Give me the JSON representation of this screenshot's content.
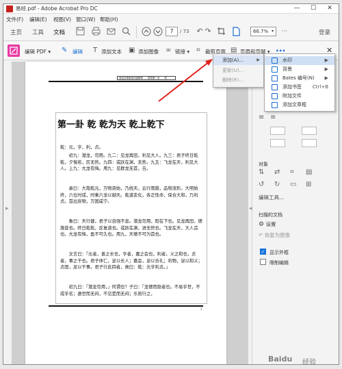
{
  "window": {
    "title": "易经.pdf - Adobe Acrobat Pro DC",
    "controls": [
      "—",
      "☐",
      "✕"
    ]
  },
  "menubar": [
    "文件(F)",
    "编辑(E)",
    "视图(V)",
    "窗口(W)",
    "帮助(H)"
  ],
  "toolbar": {
    "tabs": [
      "主页",
      "工具",
      "文档"
    ],
    "page_current": "7",
    "page_total": "/ 73",
    "zoom": "66.7%",
    "login": "登录"
  },
  "edit_toolbar": {
    "edit_pdf": "编辑 PDF ▾",
    "edit": "编辑",
    "add_text": "添加文本",
    "add_image": "添加图像",
    "link": "链接 ▾",
    "crop": "裁剪页面",
    "header_footer": "页眉和页脚 ▾",
    "more": "•••"
  },
  "dropdown_primary": {
    "items": [
      {
        "label": "添加(A)...",
        "highlighted": true,
        "disabled": false
      },
      {
        "label": "更新(U)...",
        "highlighted": false,
        "disabled": true
      },
      {
        "label": "删除(R)...",
        "highlighted": false,
        "disabled": true
      }
    ]
  },
  "dropdown_secondary": {
    "items": [
      {
        "label": "水印",
        "shortcut": "",
        "submenu": true,
        "highlighted": true
      },
      {
        "label": "背景",
        "shortcut": "",
        "submenu": true,
        "highlighted": false
      },
      {
        "label": "Bates 编号(N)",
        "shortcut": "",
        "submenu": true,
        "highlighted": false
      },
      {
        "label": "添加书签",
        "shortcut": "Ctrl+B",
        "submenu": false,
        "highlighted": false
      },
      {
        "label": "附加文件",
        "shortcut": "",
        "submenu": false,
        "highlighted": false
      },
      {
        "label": "添加文章框",
        "shortcut": "",
        "submenu": false,
        "highlighted": false
      }
    ]
  },
  "document": {
    "running_header": "易经卦象解读详细解释　　周易第一卦　　乾",
    "page_number": "1",
    "heading": "第一卦 乾 乾为天 乾上乾下",
    "paragraphs": [
      "乾：元，亨，利，贞。",
      "　　初九：潜龙，勿用。九二：见龙再田，利见大人。九三：君子终日乾乾，夕惕若，厉无咎。九四：或跃在渊，无咎。九五：飞龙在天，利见大人。上九：亢龙有悔。用九：见群龙无首，吉。",
      "　　彖曰：大哉乾元，万物资始，乃统天。云行雨施，品物流形。大明始终，六位时成，时乘六龙以御天。乾道变化，各正性命，保合大和，乃利贞。首出庶物，万国咸宁。",
      "　　象曰：天行健，君子以自强不息。潜龙勿用，阳在下也。见龙再田，德施普也。终日乾乾，反复道也。或跃在渊，进无咎也。飞龙在天，大人造也。亢龙有悔，盈不可久也。用九，天德不可为首也。",
      "　　文言曰：「元者，善之长也，亨者，嘉之会也，利者，义之和也，贞者，事之干也。君子体仁，足以长人；嘉会，足以合礼；利物，足以和义；贞固，足以干事。君子行此四者，故曰：乾：元亨利贞。」",
      "　　初九曰：「潜龙勿用，」何谓也？子曰：「龙德而隐者也。不易乎世，不成乎名；遯世而无闷，不见是而无闷；乐则行之，"
    ]
  },
  "right_pane": {
    "object_label": "对象",
    "edit_tools": "编辑工具...",
    "scanned_label": "扫描的文档",
    "settings": "设置",
    "restore": "恢复为图像",
    "show_bbox": "显示外框",
    "show_bbox_checked": true,
    "restrict_edit": "限制编辑",
    "restrict_edit_checked": false
  },
  "watermark": {
    "brand": "Baidu",
    "suffix": "经验"
  },
  "colors": {
    "accent": "#1a6dd1",
    "menu_highlight": "#cfe0f5",
    "arrow": "#e0221b",
    "edit_pdf_icon": "#e83aa4"
  }
}
